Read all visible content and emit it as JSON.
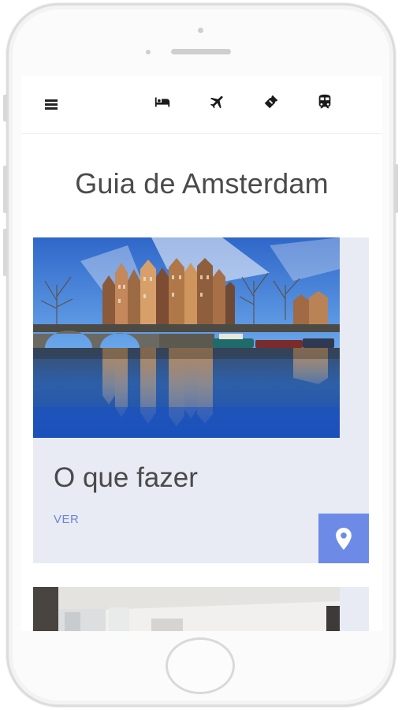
{
  "header": {
    "menu_icon": "hamburger-menu-icon",
    "nav_icons": [
      "bed-icon",
      "airplane-icon",
      "ticket-icon",
      "train-icon"
    ]
  },
  "page": {
    "title": "Guia de Amsterdam"
  },
  "cards": [
    {
      "image": "amsterdam-canal-photo",
      "title": "O que fazer",
      "link_label": "VER",
      "action_icon": "map-pin-icon"
    },
    {
      "image": "interior-room-photo"
    }
  ],
  "colors": {
    "accent": "#6d8be6",
    "link": "#6b86d8",
    "card_background": "#e8ebf4",
    "title_text": "#4a4a4a"
  }
}
